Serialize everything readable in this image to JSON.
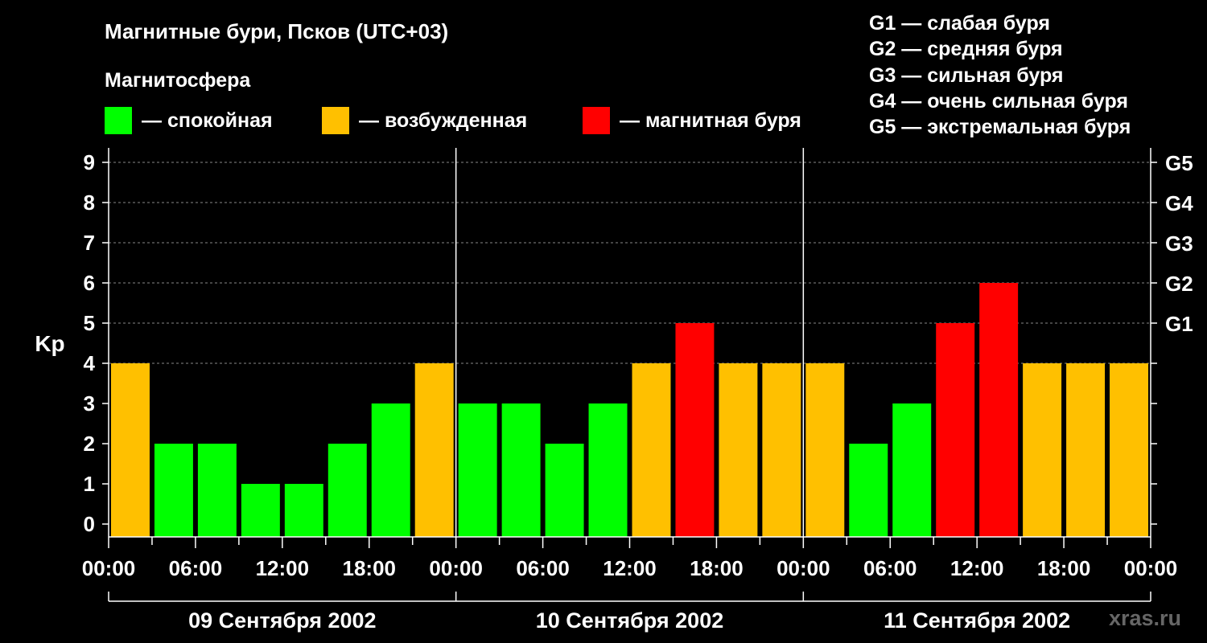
{
  "title": "Магнитные бури, Псков (UTC+03)",
  "legend": {
    "title": "Магнитосфера",
    "items": [
      {
        "label": "— спокойная",
        "color": "#00ff00"
      },
      {
        "label": "— возбужденная",
        "color": "#ffc000"
      },
      {
        "label": "— магнитная буря",
        "color": "#ff0000"
      }
    ]
  },
  "g_scale_legend": [
    "G1 — слабая буря",
    "G2 — средняя буря",
    "G3 — сильная буря",
    "G4 — очень сильная буря",
    "G5 — экстремальная буря"
  ],
  "watermark": "xras.ru",
  "colors": {
    "quiet": "#00ff00",
    "active": "#ffc000",
    "storm": "#ff0000",
    "background": "#000000",
    "axis": "#ffffff",
    "grid": "#888888"
  },
  "chart_data": {
    "type": "bar",
    "ylabel": "Kp",
    "ylim": [
      0,
      9
    ],
    "yticks": [
      "0",
      "1",
      "2",
      "3",
      "4",
      "5",
      "6",
      "7",
      "8",
      "9"
    ],
    "right_axis_labels": [
      {
        "kp": 5,
        "label": "G1"
      },
      {
        "kp": 6,
        "label": "G2"
      },
      {
        "kp": 7,
        "label": "G3"
      },
      {
        "kp": 8,
        "label": "G4"
      },
      {
        "kp": 9,
        "label": "G5"
      }
    ],
    "xtick_labels": [
      "00:00",
      "06:00",
      "12:00",
      "18:00",
      "00:00",
      "06:00",
      "12:00",
      "18:00",
      "00:00",
      "06:00",
      "12:00",
      "18:00",
      "00:00"
    ],
    "days": [
      "09 Сентября 2002",
      "10 Сентября 2002",
      "11 Сентября 2002"
    ],
    "interval_hours": 3,
    "values": [
      4,
      2,
      2,
      1,
      1,
      2,
      3,
      4,
      3,
      3,
      2,
      3,
      4,
      5,
      4,
      4,
      4,
      2,
      3,
      5,
      6,
      4,
      4,
      4
    ],
    "categories": [
      "quiet-if-below-4",
      "active-at-4",
      "storm-at-5-plus"
    ],
    "grid": true,
    "grid_lines_at": [
      4,
      5,
      6,
      7,
      8,
      9
    ]
  }
}
